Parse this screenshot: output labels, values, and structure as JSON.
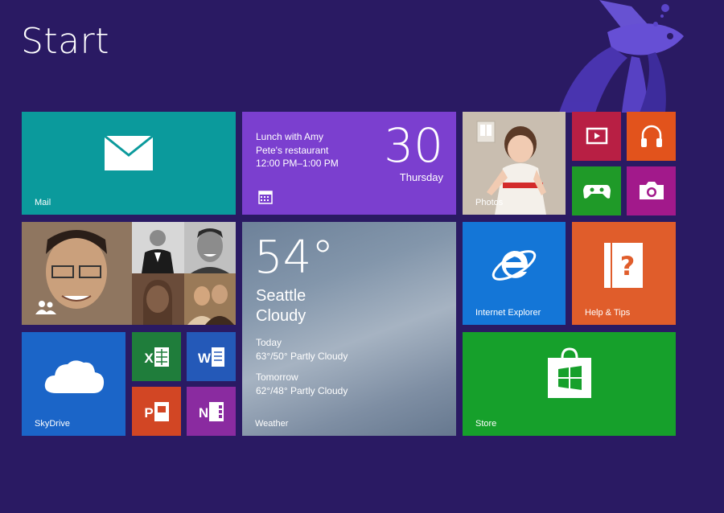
{
  "screen": {
    "title": "Start",
    "background_color": "#2a1a63"
  },
  "tiles": {
    "mail": {
      "label": "Mail",
      "icon": "envelope-icon",
      "color": "#0b9a9c"
    },
    "calendar": {
      "event_title": "Lunch with Amy",
      "event_location": "Pete's restaurant",
      "event_time": "12:00 PM–1:00 PM",
      "day_number": "30",
      "day_name": "Thursday",
      "icon": "calendar-icon",
      "color": "#7b3fcf"
    },
    "photos": {
      "label": "Photos"
    },
    "video": {
      "icon": "video-icon",
      "color": "#b81f44"
    },
    "music": {
      "icon": "headphones-icon",
      "color": "#e2531c"
    },
    "games": {
      "icon": "gamepad-icon",
      "color": "#1f9a28"
    },
    "camera": {
      "icon": "camera-icon",
      "color": "#a2198b"
    },
    "people": {
      "icon": "people-icon"
    },
    "weather": {
      "temperature": "54°",
      "city": "Seattle",
      "condition": "Cloudy",
      "today_label": "Today",
      "today_forecast": "63°/50° Partly Cloudy",
      "tomorrow_label": "Tomorrow",
      "tomorrow_forecast": "62°/48° Partly Cloudy",
      "label": "Weather"
    },
    "internet_explorer": {
      "label": "Internet Explorer",
      "icon": "internet-explorer-icon",
      "color": "#1476d7"
    },
    "help_tips": {
      "label": "Help & Tips",
      "icon": "help-book-icon",
      "color": "#e05d2b"
    },
    "skydrive": {
      "label": "SkyDrive",
      "icon": "cloud-icon",
      "color": "#1b65c8"
    },
    "excel": {
      "letter": "X",
      "icon": "excel-icon",
      "color": "#1f7d3b"
    },
    "word": {
      "letter": "W",
      "icon": "word-icon",
      "color": "#2459b8"
    },
    "powerpoint": {
      "letter": "P",
      "icon": "powerpoint-icon",
      "color": "#d24624"
    },
    "onenote": {
      "letter": "N",
      "icon": "onenote-icon",
      "color": "#8a2ba0"
    },
    "store": {
      "label": "Store",
      "icon": "store-bag-icon",
      "color": "#16a02b"
    }
  }
}
